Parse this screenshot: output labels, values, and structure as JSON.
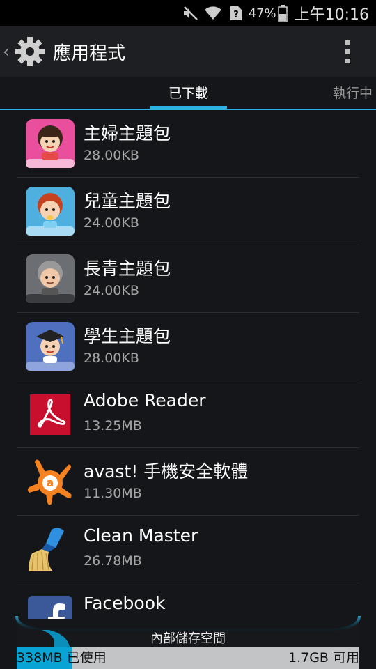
{
  "status_bar": {
    "battery_percent": "47%",
    "time": "上午10:16",
    "icons": [
      "muted-icon",
      "wifi-icon",
      "no-sim-icon",
      "battery-icon"
    ]
  },
  "action_bar": {
    "title": "應用程式",
    "icon": "settings-gear-icon",
    "menu_icon": "overflow-menu-icon"
  },
  "tabs": {
    "downloaded": "已下載",
    "running": "執行中"
  },
  "apps": [
    {
      "name": "主婦主題包",
      "size": "28.00KB",
      "icon": "housewife-theme-icon"
    },
    {
      "name": "兒童主題包",
      "size": "24.00KB",
      "icon": "kids-theme-icon"
    },
    {
      "name": "長青主題包",
      "size": "24.00KB",
      "icon": "senior-theme-icon"
    },
    {
      "name": "學生主題包",
      "size": "28.00KB",
      "icon": "student-theme-icon"
    },
    {
      "name": "Adobe Reader",
      "size": "13.25MB",
      "icon": "adobe-reader-icon"
    },
    {
      "name": "avast! 手機安全軟體",
      "size": "11.30MB",
      "icon": "avast-icon"
    },
    {
      "name": "Clean Master",
      "size": "26.78MB",
      "icon": "clean-master-icon"
    },
    {
      "name": "Facebook",
      "size": "",
      "icon": "facebook-icon"
    }
  ],
  "storage": {
    "title": "內部儲存空間",
    "used": "338MB 已使用",
    "free": "1.7GB 可用",
    "used_fraction": 0.16
  },
  "colors": {
    "accent": "#2db2e5",
    "storage_used": "#0aa3d6",
    "background": "#141619"
  }
}
